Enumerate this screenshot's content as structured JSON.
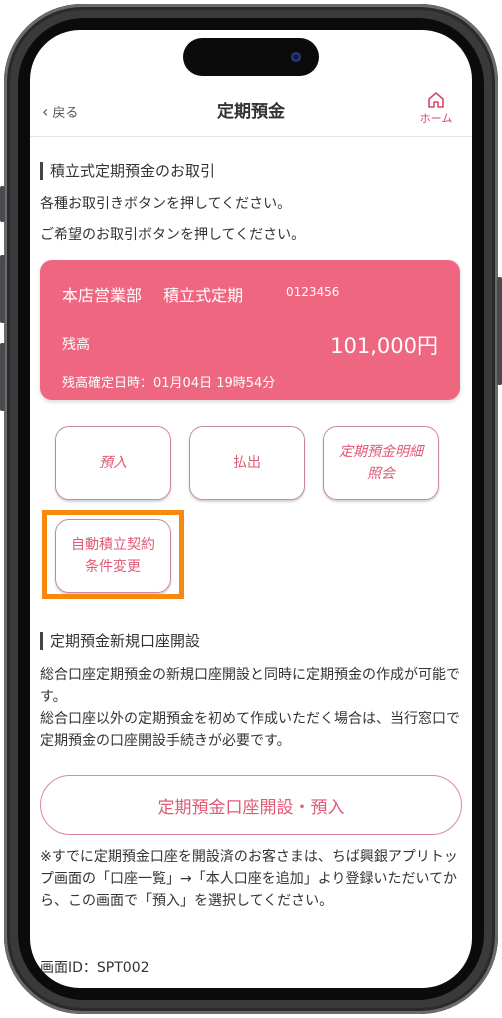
{
  "navbar": {
    "back_label": "戻る",
    "title": "定期預金",
    "home_label": "ホーム"
  },
  "section1": {
    "heading": "積立式定期預金のお取引",
    "line1": "各種お取引きボタンを押してください。",
    "line2": "ご希望のお取引ボタンを押してください。"
  },
  "account_card": {
    "branch_type": "本店営業部　 積立式定期",
    "account_number": "0123456",
    "balance_label": "残高",
    "balance": "101,000円",
    "updated": "残高確定日時：01月04日 19時54分",
    "color": "#ee6680"
  },
  "actions": {
    "deposit": "預入",
    "withdraw": "払出",
    "statement": "定期預金明細\n照会",
    "auto_contract": "自動積立契約\n条件変更"
  },
  "section2": {
    "heading": "定期預金新規口座開設",
    "body1": "総合口座定期預金の新規口座開設と同時に定期預金の作成が可能です。",
    "body2": "総合口座以外の定期預金を初めて作成いただく場合は、当行窓口で定期預金の口座開設手続きが必要です。",
    "open_button": "定期預金口座開設・預入",
    "note": "※すでに定期預金口座を開設済のお客さまは、ちば興銀アプリトップ画面の「口座一覧」→「本人口座を追加」より登録いただいてから、この画面で「預入」を選択してください。"
  },
  "footer": {
    "screen_id": "画面ID：SPT002"
  },
  "colors": {
    "accent": "#e05a75",
    "highlight": "#f7890f"
  }
}
